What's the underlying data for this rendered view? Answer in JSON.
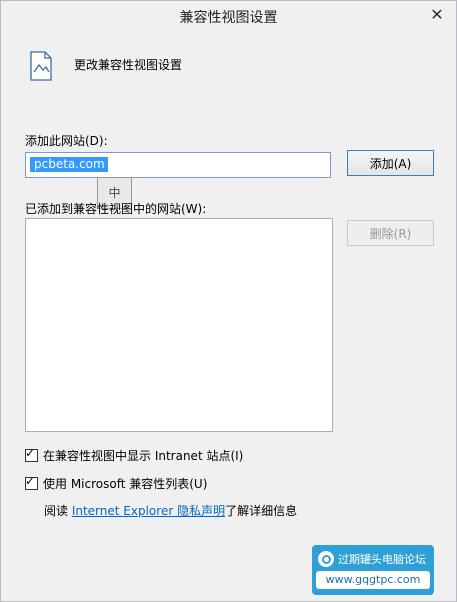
{
  "window": {
    "title": "兼容性视图设置",
    "close_glyph": "✕"
  },
  "header": {
    "title": "更改兼容性视图设置",
    "icon": "page-image-icon"
  },
  "add_site": {
    "label": "添加此网站(D):",
    "input_value": "pcbeta.com",
    "add_button": "添加(A)"
  },
  "ime_indicator": "中",
  "sites": {
    "label": "已添加到兼容性视图中的网站(W):",
    "remove_button": "删除(R)",
    "items": []
  },
  "options": [
    {
      "label": "在兼容性视图中显示 Intranet 站点(I)",
      "checked": true
    },
    {
      "label": "使用 Microsoft 兼容性列表(U)",
      "checked": true
    }
  ],
  "privacy": {
    "prefix": "阅读 ",
    "link": "Internet Explorer 隐私声明",
    "suffix": "了解详细信息"
  },
  "watermark": {
    "title": "过期罐头电脑论坛",
    "url": "www.gqgtpc.com"
  },
  "colors": {
    "selection": "#3399ff",
    "link": "#0066cc",
    "watermark_bg": "#2f9fd8",
    "disabled_text": "#999999"
  }
}
